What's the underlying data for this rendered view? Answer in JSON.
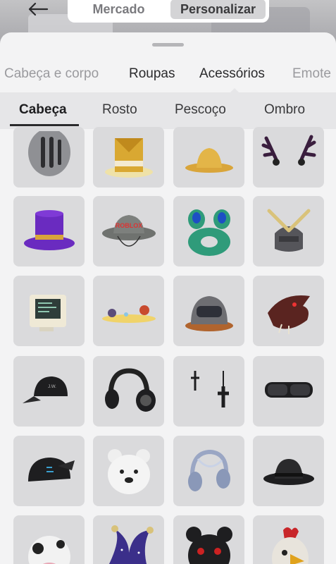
{
  "top_nav": {
    "back_icon": "arrow-left-icon",
    "tabs": [
      {
        "label": "Mercado",
        "active": false
      },
      {
        "label": "Personalizar",
        "active": true
      }
    ]
  },
  "categories": [
    {
      "label": "Cabeça e corpo",
      "active": false
    },
    {
      "label": "Roupas",
      "active": false
    },
    {
      "label": "Acessórios",
      "active": true
    },
    {
      "label": "Emote",
      "active": false
    }
  ],
  "subcategories": [
    {
      "label": "Cabeça",
      "active": true
    },
    {
      "label": "Rosto",
      "active": false
    },
    {
      "label": "Pescoço",
      "active": false
    },
    {
      "label": "Ombro",
      "active": false
    }
  ],
  "items": [
    {
      "icon": "knight-helmet-icon"
    },
    {
      "icon": "golden-top-hat-icon"
    },
    {
      "icon": "straw-hat-icon"
    },
    {
      "icon": "dark-antlers-icon"
    },
    {
      "icon": "purple-top-hat-icon"
    },
    {
      "icon": "roblox-bucket-hat-icon"
    },
    {
      "icon": "frog-float-ring-icon"
    },
    {
      "icon": "samurai-helmet-icon"
    },
    {
      "icon": "retro-monitor-helmet-icon"
    },
    {
      "icon": "planet-halo-icon"
    },
    {
      "icon": "space-helmet-icon"
    },
    {
      "icon": "dragon-head-icon"
    },
    {
      "icon": "black-cap-icon"
    },
    {
      "icon": "black-headphones-icon"
    },
    {
      "icon": "cross-earrings-icon"
    },
    {
      "icon": "black-goggles-icon"
    },
    {
      "icon": "black-backwards-cap-icon"
    },
    {
      "icon": "white-bear-head-icon"
    },
    {
      "icon": "silver-headphones-icon"
    },
    {
      "icon": "black-fedora-icon"
    },
    {
      "icon": "cow-head-icon"
    },
    {
      "icon": "jester-hat-icon"
    },
    {
      "icon": "dark-bear-head-icon"
    },
    {
      "icon": "rooster-head-icon"
    }
  ]
}
